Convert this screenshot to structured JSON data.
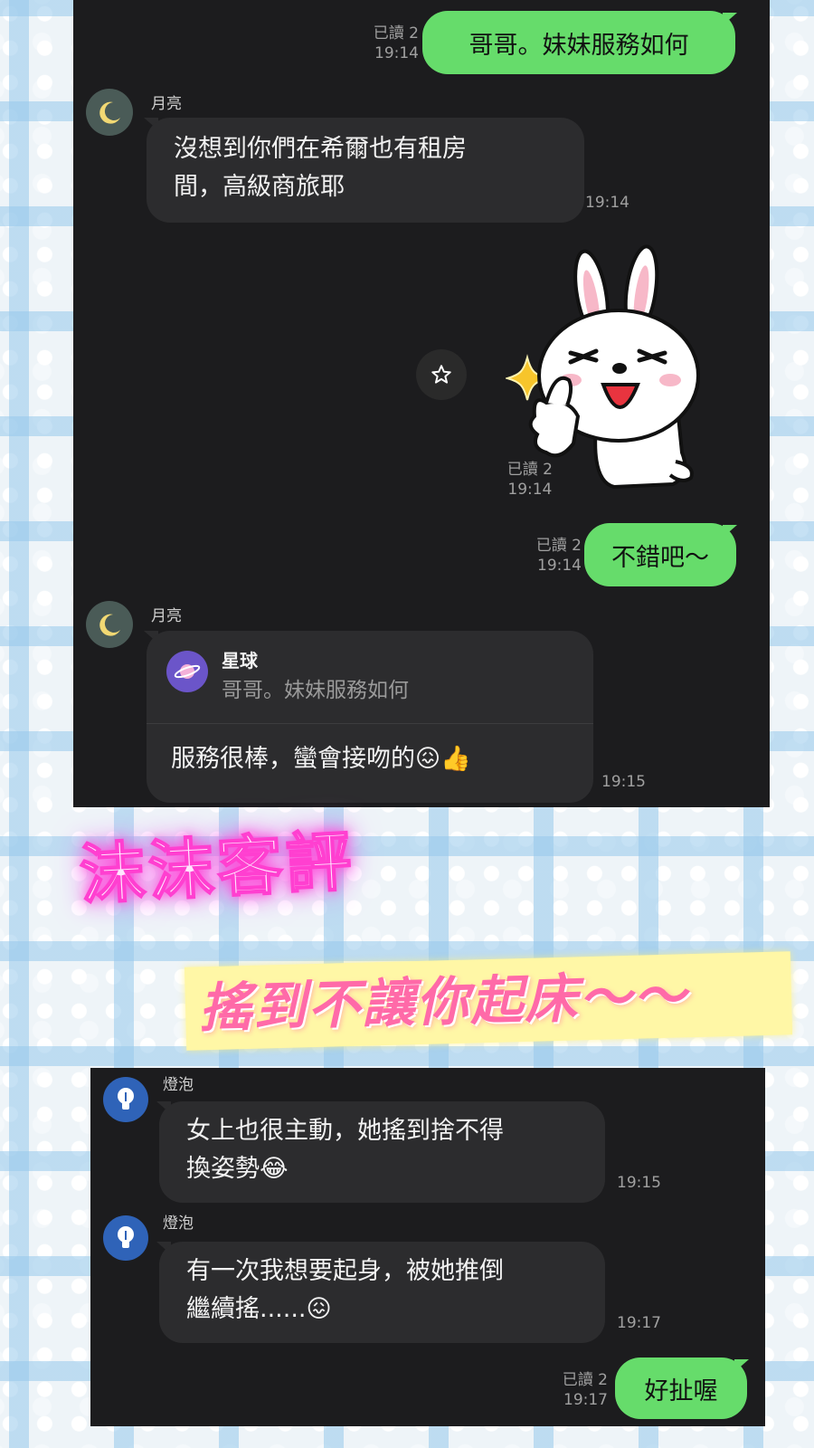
{
  "top_chat": {
    "out1": {
      "read": "已讀 2",
      "time": "19:14",
      "text": "哥哥。妹妹服務如何"
    },
    "moon_msg1": {
      "sender": "月亮",
      "line1": "沒想到你們在希爾也有租房",
      "line2": "間，高級商旅耶",
      "time": "19:14"
    },
    "sticker": {
      "read": "已讀 2",
      "time": "19:14"
    },
    "out2": {
      "read": "已讀 2",
      "time": "19:14",
      "text": "不錯吧～"
    },
    "moon_msg2": {
      "sender": "月亮",
      "reply_name": "星球",
      "reply_text": "哥哥。妹妹服務如何",
      "text": "服務很棒，蠻會接吻的😖👍",
      "time": "19:15"
    }
  },
  "promo": {
    "title": "沫沫客評",
    "subtitle": "搖到不讓你起床～～"
  },
  "bottom_chat": {
    "bulb_msg1": {
      "sender": "燈泡",
      "line1": "女上也很主動，她搖到捨不得",
      "line2": "換姿勢😂",
      "time": "19:15"
    },
    "bulb_msg2": {
      "sender": "燈泡",
      "line1": "有一次我想要起身，被她推倒",
      "line2": "繼續搖......😖",
      "time": "19:17"
    },
    "out3": {
      "read": "已讀 2",
      "time": "19:17",
      "text": "好扯喔"
    }
  },
  "colors": {
    "chat_bg": "#1c1c1e",
    "incoming_bubble": "#2c2c2e",
    "outgoing_bubble": "#66dc6b",
    "promo_pink": "#ff6aa8",
    "promo_band": "#fff7a6"
  },
  "icons": [
    "moon-icon",
    "bulb-icon",
    "planet-icon",
    "star-outline-icon",
    "cony-rabbit-sticker",
    "sparkle-icon"
  ]
}
